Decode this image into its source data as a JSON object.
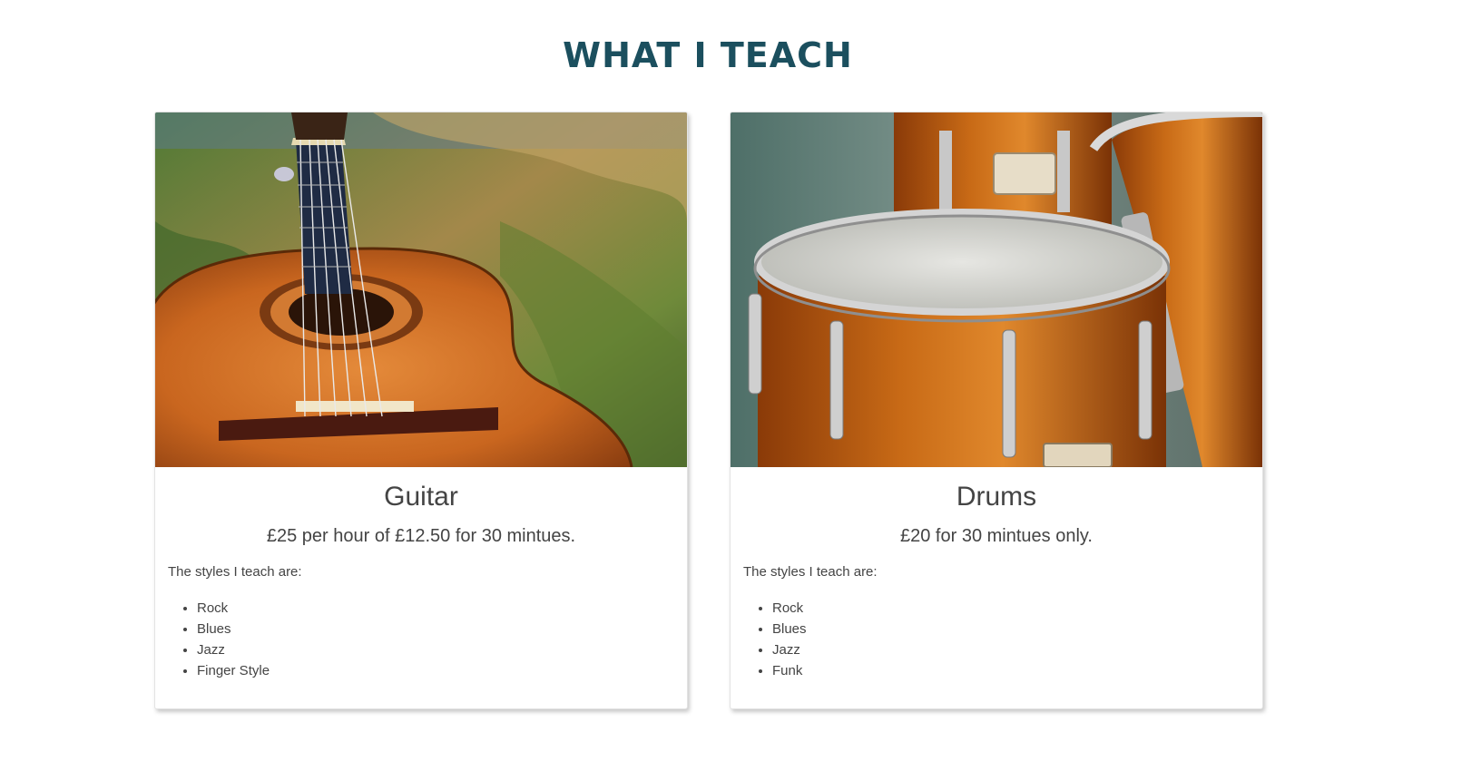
{
  "section": {
    "title": "WHAT I TEACH"
  },
  "cards": [
    {
      "title": "Guitar",
      "price": "£25 per hour of £12.50 for 30 mintues.",
      "intro": "The styles I teach are:",
      "styles": [
        "Rock",
        "Blues",
        "Jazz",
        "Finger Style"
      ],
      "image_subject": "acoustic guitar lying in grass"
    },
    {
      "title": "Drums",
      "price": "£20 for 30 mintues only.",
      "intro": "The styles I teach are:",
      "styles": [
        "Rock",
        "Blues",
        "Jazz",
        "Funk"
      ],
      "image_subject": "orange drum kit"
    }
  ],
  "colors": {
    "title": "#1b4f5e",
    "text": "#444444",
    "card_border": "#e3e3e3"
  }
}
